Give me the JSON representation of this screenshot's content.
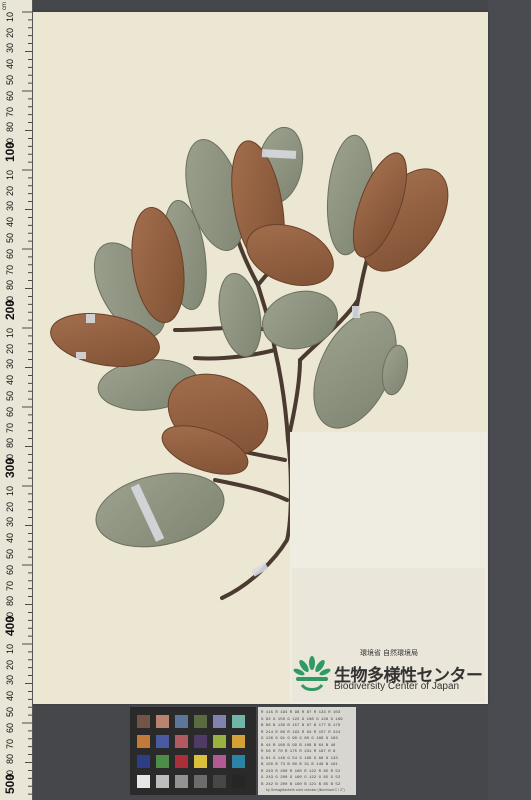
{
  "ruler": {
    "label": "cm",
    "major_ticks": [
      "100",
      "200",
      "300",
      "400",
      "500"
    ],
    "minor_labels": [
      "10",
      "20",
      "30",
      "40",
      "50",
      "60",
      "70",
      "80",
      "90",
      "10",
      "20",
      "30",
      "40",
      "50",
      "60",
      "70",
      "80",
      "90",
      "10",
      "20",
      "30",
      "40",
      "50",
      "60",
      "70",
      "80",
      "90",
      "10",
      "20",
      "30",
      "40",
      "50",
      "60",
      "70",
      "80",
      "90",
      "10",
      "20",
      "30",
      "40",
      "50",
      "60",
      "70",
      "80",
      "90"
    ]
  },
  "logo": {
    "agency": "環境省 自然環境局",
    "center_jp": "生物多様性センター",
    "center_en": "Biodiversity Center of Japan"
  },
  "color_checker": {
    "swatches": [
      "#735448",
      "#b8846f",
      "#5d7599",
      "#5a6b3f",
      "#8082b0",
      "#6fb6a8",
      "#c2793a",
      "#4a5aa0",
      "#b25962",
      "#4e3b66",
      "#98b13f",
      "#d4a136",
      "#2e3e86",
      "#4d8d47",
      "#a83139",
      "#dbc03c",
      "#b15a94",
      "#2b84a5",
      "#e6e6e4",
      "#bdbdbb",
      "#939391",
      "#6c6c6a",
      "#474746",
      "#262626"
    ]
  },
  "datasheet": {
    "lines": [
      "R 115  R 194  R  98  R  87  R 133  R 103",
      "G  82  G 150  G 122  G 108  G 128  G 189",
      "B  68  B 130  B 157  B  67  B 177  B 170",
      "R 214  R  80  R 193  R  94  R 157  R 224",
      "G 126  G  91  G  90  G  60  G 188  G 163",
      "B  44  B 166  B  99  B 108  B  64  B  46",
      "R  56  R  70  R 175  R 231  R 187  R   8",
      "G  61  G 148  G  54  G 199  G  86  G 133",
      "B 150  B  73  B  60  B  31  B 149  B 161",
      "R 243  R 200  R 160  R 122  R  85  R  52",
      "G 243  G 200  G 160  G 122  G  85  G  52",
      "B 242  B 200  B 160  B 121  B  85  B  52"
    ],
    "credit": "by GretagMacbeth color checker (Illuminant C / 2°)"
  }
}
